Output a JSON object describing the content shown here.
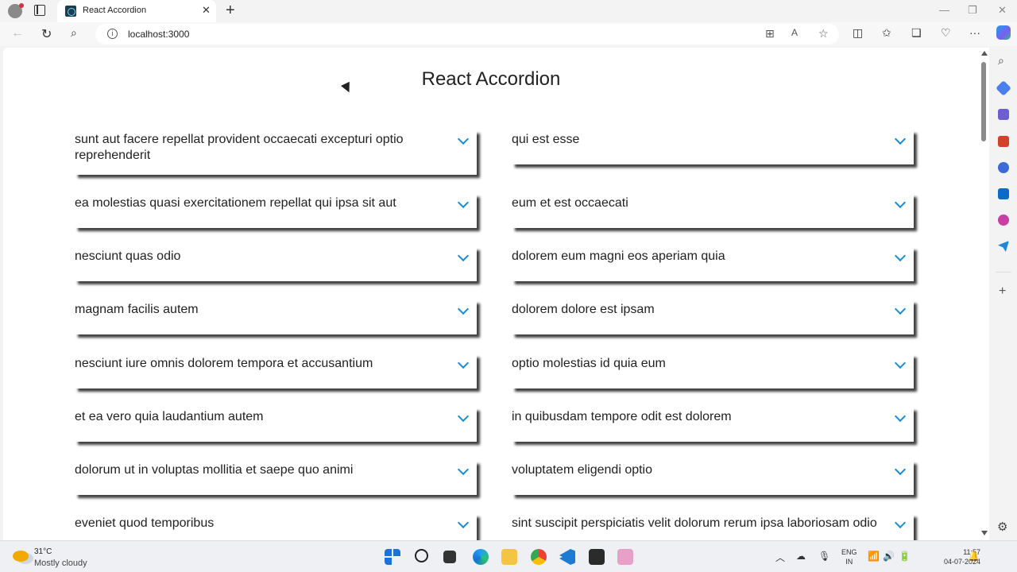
{
  "browser": {
    "tab_title": "React Accordion",
    "tab_close": "✕",
    "new_tab": "+",
    "url": "localhost:3000"
  },
  "page": {
    "title": "React Accordion",
    "left_column": [
      "sunt aut facere repellat provident occaecati excepturi optio reprehenderit",
      "ea molestias quasi exercitationem repellat qui ipsa sit aut",
      "nesciunt quas odio",
      "magnam facilis autem",
      "nesciunt iure omnis dolorem tempora et accusantium",
      "et ea vero quia laudantium autem",
      "dolorum ut in voluptas mollitia et saepe quo animi",
      "eveniet quod temporibus"
    ],
    "right_column": [
      "qui est esse",
      "eum et est occaecati",
      "dolorem eum magni eos aperiam quia",
      "dolorem dolore est ipsam",
      "optio molestias id quia eum",
      "in quibusdam tempore odit est dolorem",
      "voluptatem eligendi optio",
      "sint suscipit perspiciatis velit dolorum rerum ipsa laboriosam odio"
    ]
  },
  "taskbar": {
    "temperature": "31°C",
    "condition": "Mostly cloudy",
    "lang_top": "ENG",
    "lang_bottom": "IN",
    "time": "11:57",
    "date": "04-07-2024"
  },
  "colors": {
    "accent": "#1a8fd6",
    "title_text": "#222222"
  }
}
